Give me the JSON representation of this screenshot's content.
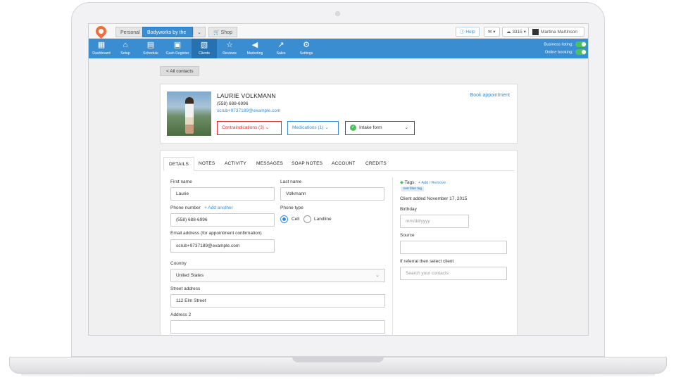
{
  "topbar": {
    "tabs": [
      "Personal",
      "Bodyworks by the Bay",
      "Shop"
    ],
    "help": "Help",
    "count": "3315",
    "user": "Martina Martinson"
  },
  "nav": {
    "items": [
      {
        "label": "Dashboard",
        "icon": "dashboard-icon"
      },
      {
        "label": "Setup",
        "icon": "setup-icon"
      },
      {
        "label": "Schedule",
        "icon": "calendar-icon"
      },
      {
        "label": "Cash Register",
        "icon": "register-icon"
      },
      {
        "label": "Clients",
        "icon": "clients-icon"
      },
      {
        "label": "Reviews",
        "icon": "star-icon"
      },
      {
        "label": "Marketing",
        "icon": "megaphone-icon"
      },
      {
        "label": "Sales",
        "icon": "chart-icon"
      },
      {
        "label": "Settings",
        "icon": "gear-icon"
      }
    ],
    "active_index": 4,
    "business_listing": "Business listing:",
    "online_booking": "Online booking:"
  },
  "back_label": "< All contacts",
  "client": {
    "name": "LAURIE VOLKMANN",
    "phone": "(558) 688-6996",
    "email": "scrub+9737189@example.com",
    "book": "Book appointment",
    "contraindications": "Contraindications (3)",
    "medications": "Medications (1)",
    "intake": "Intake form"
  },
  "tabs": [
    "DETAILS",
    "NOTES",
    "ACTIVITY",
    "MESSAGES",
    "SOAP NOTES",
    "ACCOUNT",
    "CREDITS"
  ],
  "form": {
    "first_name_label": "First name",
    "first_name": "Laurie",
    "last_name_label": "Last name",
    "last_name": "Volkmann",
    "phone_label": "Phone number",
    "add_another": "+ Add another",
    "phone": "(558) 688-6996",
    "phone_type_label": "Phone type",
    "cell": "Cell",
    "landline": "Landline",
    "email_label": "Email address (for appointment confirmation)",
    "email": "scrub+9737189@example.com",
    "country_label": "Country",
    "country": "United States",
    "street_label": "Street address",
    "street": "112 Elm Street",
    "address2_label": "Address 2"
  },
  "side": {
    "tags_label": "Tags:",
    "add_remove": "Add / Remove",
    "tag": "test filter tag",
    "client_added": "Client added November 17, 2015",
    "birthday_label": "Birthday",
    "birthday_placeholder": "mm/dd/yyyy",
    "source_label": "Source",
    "referral_label": "If referral then select client",
    "search_placeholder": "Search your contacts"
  },
  "colors": {
    "brand": "#3a8dd1",
    "alert": "#d9322e",
    "success": "#4cc25b",
    "logo": "#f26c3d"
  }
}
